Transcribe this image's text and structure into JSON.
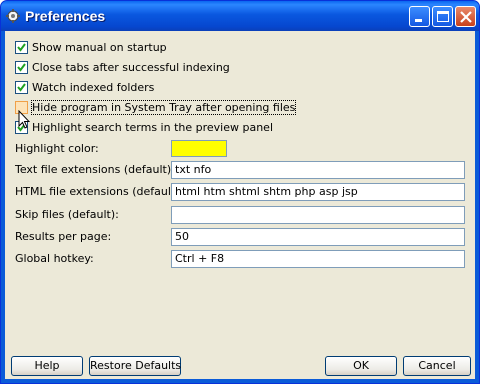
{
  "window": {
    "title": "Preferences",
    "icons": {
      "app": "gear-app-icon",
      "minimize": "minimize-icon",
      "maximize": "maximize-icon",
      "close": "close-icon"
    }
  },
  "checkboxes": [
    {
      "label": "Show manual on startup",
      "checked": true
    },
    {
      "label": "Close tabs after successful indexing",
      "checked": true
    },
    {
      "label": "Watch indexed folders",
      "checked": true
    },
    {
      "label": "Hide program in System Tray after opening files",
      "checked": false
    },
    {
      "label": "Highlight search terms in the preview panel",
      "checked": true
    }
  ],
  "highlight_color": {
    "label": "Highlight color:",
    "value": "#ffff00"
  },
  "fields": [
    {
      "label": "Text file extensions (default):",
      "value": "txt nfo"
    },
    {
      "label": "HTML file extensions (default):",
      "value": "html htm shtml shtm php asp jsp"
    },
    {
      "label": "Skip files (default):",
      "value": ""
    },
    {
      "label": "Results per page:",
      "value": "50"
    },
    {
      "label": "Global hotkey:",
      "value": "Ctrl + F8"
    }
  ],
  "buttons": {
    "help": "Help",
    "restore_defaults": "Restore Defaults",
    "ok": "OK",
    "cancel": "Cancel"
  }
}
